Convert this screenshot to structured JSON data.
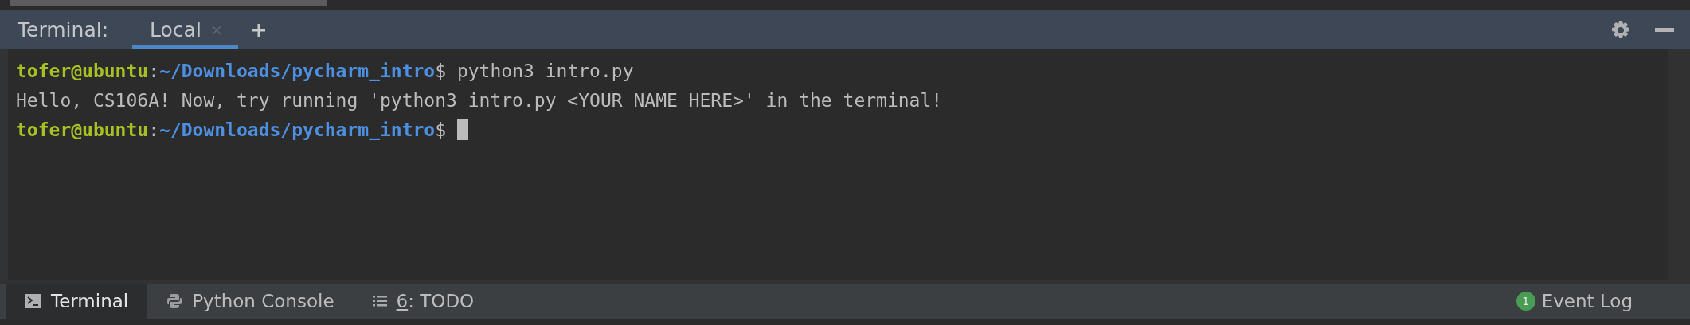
{
  "header": {
    "title": "Terminal:",
    "tabs": [
      {
        "label": "Local",
        "selected": true
      }
    ]
  },
  "terminal": {
    "lines": [
      {
        "kind": "prompt",
        "user": "tofer@ubuntu",
        "separator": ":",
        "path": "~/Downloads/pycharm_intro",
        "symbol": "$",
        "command": " python3 intro.py"
      },
      {
        "kind": "output",
        "text": "Hello, CS106A! Now, try running 'python3 intro.py <YOUR NAME HERE>' in the terminal!"
      },
      {
        "kind": "prompt",
        "user": "tofer@ubuntu",
        "separator": ":",
        "path": "~/Downloads/pycharm_intro",
        "symbol": "$"
      }
    ]
  },
  "tool_windows": [
    {
      "kind": "terminal",
      "label": "Terminal",
      "selected": true
    },
    {
      "kind": "python",
      "label": "Python Console",
      "selected": false
    },
    {
      "kind": "todo",
      "mnemonic": "6",
      "label": ": TODO",
      "selected": false
    }
  ],
  "event_log": {
    "badge": "1",
    "label": "Event Log"
  }
}
